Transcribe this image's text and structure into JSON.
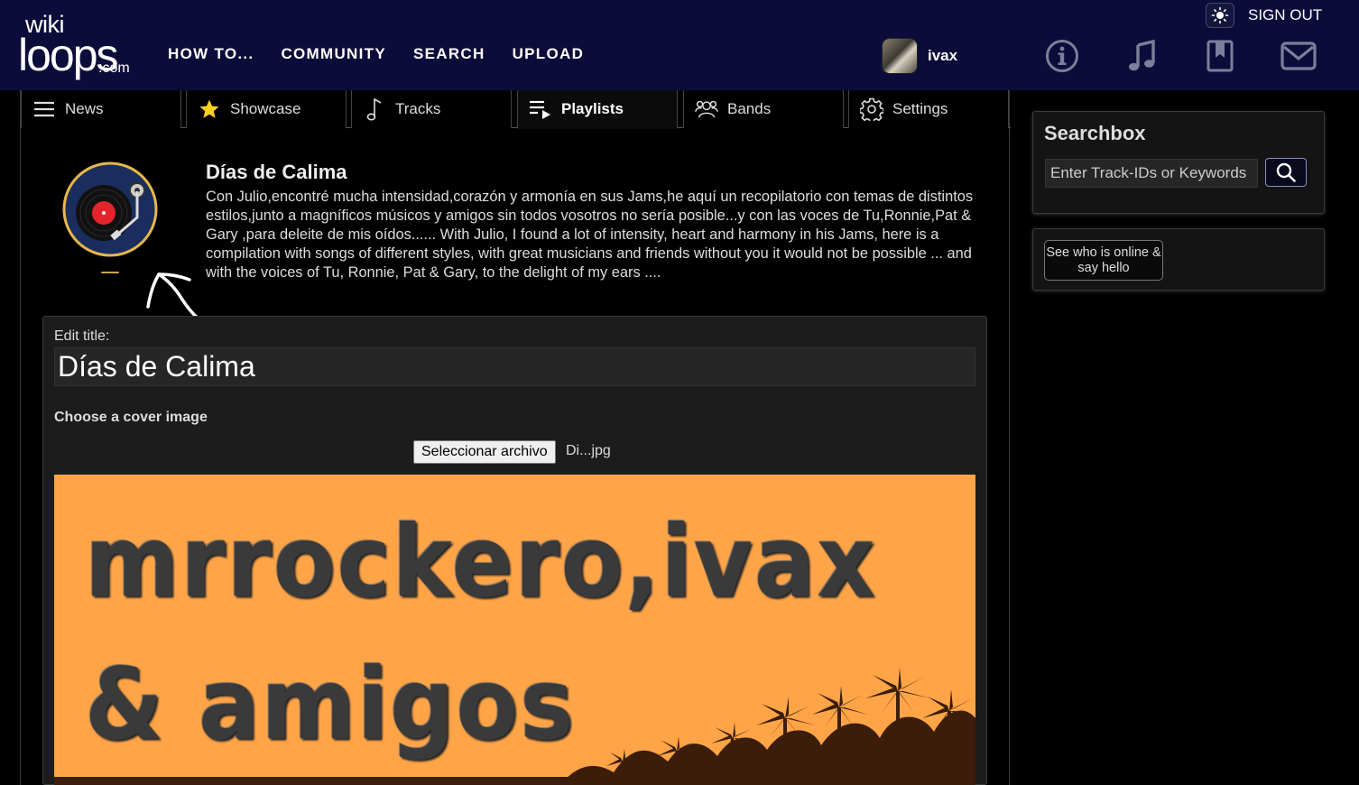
{
  "header": {
    "logo": {
      "line1": "wiki",
      "line2": "loops",
      "line3": ".com"
    },
    "nav": [
      "HOW TO...",
      "COMMUNITY",
      "SEARCH",
      "UPLOAD"
    ],
    "username": "ivax",
    "sign_out": "SIGN OUT",
    "icons": [
      "info-icon",
      "music-note-icon",
      "bookmark-icon",
      "mail-icon"
    ],
    "accent_color": "#0c0c3a"
  },
  "tabs": [
    {
      "label": "News",
      "icon": "menu-icon"
    },
    {
      "label": "Showcase",
      "icon": "star-icon"
    },
    {
      "label": "Tracks",
      "icon": "music-note-icon"
    },
    {
      "label": "Playlists",
      "icon": "playlist-icon",
      "active": true
    },
    {
      "label": "Bands",
      "icon": "people-icon"
    },
    {
      "label": "Settings",
      "icon": "gear-icon"
    }
  ],
  "playlist": {
    "title": "Días de Calima",
    "description": "Con Julio,encontré mucha intensidad,corazón y armonía en sus Jams,he aquí un recopilatorio con temas de distintos estilos,junto a magníficos músicos y amigos sin todos vosotros no sería posible...y con las voces de Tu,Ronnie,Pat & Gary ,para deleite de mis oídos...... With Julio, I found a lot of intensity, heart and harmony in his Jams, here is a compilation with songs of different styles, with great musicians and friends without you it would not be possible ... and with the voices of Tu, Ronnie, Pat & Gary, to the delight of my ears ....",
    "icon": "vinyl-record-icon"
  },
  "edit": {
    "title_label": "Edit title:",
    "title_value": "Días de Calima",
    "cover_label": "Choose a cover image",
    "file_button": "Seleccionar archivo",
    "file_name": "Di...jpg",
    "cover_text_line1": "mrrockero,ivax",
    "cover_text_line2": "& amigos",
    "cover_color": "#ffa548"
  },
  "sidebar": {
    "searchbox_title": "Searchbox",
    "search_placeholder": "Enter Track-IDs or Keywords",
    "online_button": "See who is online & say hello"
  }
}
